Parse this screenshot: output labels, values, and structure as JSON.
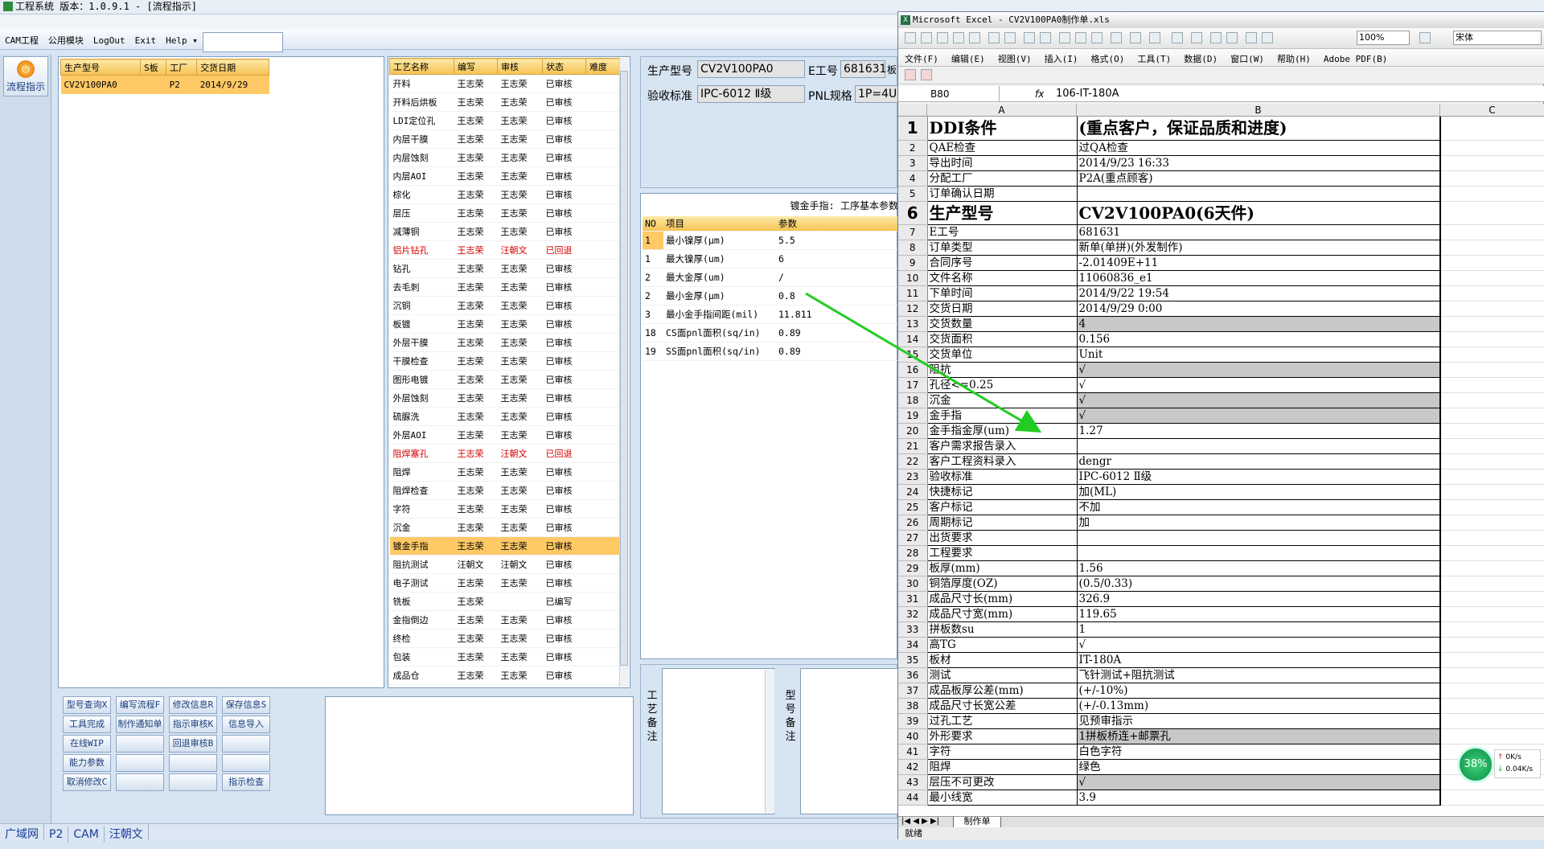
{
  "app": {
    "title": "工程系统  版本：1.0.9.1 - [流程指示]",
    "menu": [
      "CAM工程",
      "公用模块",
      "LogOut",
      "Exit",
      "Help ▾"
    ],
    "nav_button": "流程指示",
    "status_tabs": [
      "广域网",
      "P2",
      "CAM",
      "汪朝文"
    ]
  },
  "orders": {
    "columns": [
      "生产型号",
      "S板",
      "工厂",
      "交货日期"
    ],
    "rows": [
      {
        "model": "CV2V100PA0",
        "s": "",
        "factory": "P2",
        "date": "2014/9/29"
      }
    ]
  },
  "processes": {
    "columns": [
      "工艺名称",
      "编写",
      "审核",
      "状态",
      "难度"
    ],
    "rows": [
      {
        "name": "开料",
        "writer": "王志荣",
        "reviewer": "王志荣",
        "status": "已审核",
        "red": false
      },
      {
        "name": "开料后烘板",
        "writer": "王志荣",
        "reviewer": "王志荣",
        "status": "已审核",
        "red": false
      },
      {
        "name": "LDI定位孔",
        "writer": "王志荣",
        "reviewer": "王志荣",
        "status": "已审核",
        "red": false
      },
      {
        "name": "内层干膜",
        "writer": "王志荣",
        "reviewer": "王志荣",
        "status": "已审核",
        "red": false
      },
      {
        "name": "内层蚀刻",
        "writer": "王志荣",
        "reviewer": "王志荣",
        "status": "已审核",
        "red": false
      },
      {
        "name": "内层AOI",
        "writer": "王志荣",
        "reviewer": "王志荣",
        "status": "已审核",
        "red": false
      },
      {
        "name": "棕化",
        "writer": "王志荣",
        "reviewer": "王志荣",
        "status": "已审核",
        "red": false
      },
      {
        "name": "层压",
        "writer": "王志荣",
        "reviewer": "王志荣",
        "status": "已审核",
        "red": false
      },
      {
        "name": "减薄铜",
        "writer": "王志荣",
        "reviewer": "王志荣",
        "status": "已审核",
        "red": false
      },
      {
        "name": "铝片钻孔",
        "writer": "王志荣",
        "reviewer": "汪朝文",
        "status": "已回退",
        "red": true
      },
      {
        "name": "钻孔",
        "writer": "王志荣",
        "reviewer": "王志荣",
        "status": "已审核",
        "red": false
      },
      {
        "name": "去毛刺",
        "writer": "王志荣",
        "reviewer": "王志荣",
        "status": "已审核",
        "red": false
      },
      {
        "name": "沉铜",
        "writer": "王志荣",
        "reviewer": "王志荣",
        "status": "已审核",
        "red": false
      },
      {
        "name": "板镀",
        "writer": "王志荣",
        "reviewer": "王志荣",
        "status": "已审核",
        "red": false
      },
      {
        "name": "外层干膜",
        "writer": "王志荣",
        "reviewer": "王志荣",
        "status": "已审核",
        "red": false
      },
      {
        "name": "干膜检查",
        "writer": "王志荣",
        "reviewer": "王志荣",
        "status": "已审核",
        "red": false
      },
      {
        "name": "图形电镀",
        "writer": "王志荣",
        "reviewer": "王志荣",
        "status": "已审核",
        "red": false
      },
      {
        "name": "外层蚀刻",
        "writer": "王志荣",
        "reviewer": "王志荣",
        "status": "已审核",
        "red": false
      },
      {
        "name": "硫脲洗",
        "writer": "王志荣",
        "reviewer": "王志荣",
        "status": "已审核",
        "red": false
      },
      {
        "name": "外层AOI",
        "writer": "王志荣",
        "reviewer": "王志荣",
        "status": "已审核",
        "red": false
      },
      {
        "name": "阻焊塞孔",
        "writer": "王志荣",
        "reviewer": "汪朝文",
        "status": "已回退",
        "red": true
      },
      {
        "name": "阻焊",
        "writer": "王志荣",
        "reviewer": "王志荣",
        "status": "已审核",
        "red": false
      },
      {
        "name": "阻焊检查",
        "writer": "王志荣",
        "reviewer": "王志荣",
        "status": "已审核",
        "red": false
      },
      {
        "name": "字符",
        "writer": "王志荣",
        "reviewer": "王志荣",
        "status": "已审核",
        "red": false
      },
      {
        "name": "沉金",
        "writer": "王志荣",
        "reviewer": "王志荣",
        "status": "已审核",
        "red": false
      },
      {
        "name": "镀金手指",
        "writer": "王志荣",
        "reviewer": "王志荣",
        "status": "已审核",
        "red": false,
        "selected": true
      },
      {
        "name": "阻抗测试",
        "writer": "汪朝文",
        "reviewer": "汪朝文",
        "status": "已审核",
        "red": false
      },
      {
        "name": "电子测试",
        "writer": "王志荣",
        "reviewer": "王志荣",
        "status": "已审核",
        "red": false
      },
      {
        "name": "铣板",
        "writer": "王志荣",
        "reviewer": "",
        "status": "已编写",
        "red": false
      },
      {
        "name": "金指倒边",
        "writer": "王志荣",
        "reviewer": "王志荣",
        "status": "已审核",
        "red": false
      },
      {
        "name": "终检",
        "writer": "王志荣",
        "reviewer": "王志荣",
        "status": "已审核",
        "red": false
      },
      {
        "name": "包装",
        "writer": "王志荣",
        "reviewer": "王志荣",
        "status": "已审核",
        "red": false
      },
      {
        "name": "成品仓",
        "writer": "王志荣",
        "reviewer": "王志荣",
        "status": "已审核",
        "red": false
      }
    ]
  },
  "buttons": [
    [
      "型号查询X",
      "编写流程F",
      "修改信息R",
      "保存信息S"
    ],
    [
      "工具完成",
      "制作通知单",
      "指示审核K",
      "信息导入"
    ],
    [
      "在线WIP",
      "",
      "回退审核B",
      ""
    ],
    [
      "能力参数",
      "",
      "",
      ""
    ],
    [
      "取消修改C",
      "",
      "",
      "指示检查"
    ]
  ],
  "info": {
    "model_label": "生产型号",
    "model_value": "CV2V100PA0",
    "e_label": "E工号",
    "e_value": "681631",
    "e_extra": "板",
    "std_label": "验收标准",
    "std_value": "IPC-6012 Ⅱ级",
    "pnl_label": "PNL规格",
    "pnl_value": "1P=4U"
  },
  "params": {
    "title": "镀金手指: 工序基本参数",
    "columns": [
      "NO",
      "项目",
      "参数"
    ],
    "rows": [
      {
        "no": "1",
        "item": "最小镍厚(μm)",
        "value": "5.5",
        "hl": true
      },
      {
        "no": "1",
        "item": "最大镍厚(um)",
        "value": "6",
        "hl": false
      },
      {
        "no": "2",
        "item": "最大金厚(um)",
        "value": "/",
        "hl": false
      },
      {
        "no": "2",
        "item": "最小金厚(μm)",
        "value": "0.8",
        "hl": false
      },
      {
        "no": "3",
        "item": "最小金手指间距(mil)",
        "value": "11.811",
        "hl": false
      },
      {
        "no": "18",
        "item": "CS面pnl面积(sq/in)",
        "value": "0.89",
        "hl": false
      },
      {
        "no": "19",
        "item": "SS面pnl面积(sq/in)",
        "value": "0.89",
        "hl": false
      }
    ]
  },
  "memos": {
    "process_label": "工艺备注",
    "model_label": "型号备注"
  },
  "excel": {
    "title": "Microsoft Excel - CV2V100PA0制作单.xls",
    "menu": [
      "文件(F)",
      "编辑(E)",
      "视图(V)",
      "插入(I)",
      "格式(O)",
      "工具(T)",
      "数据(D)",
      "窗口(W)",
      "帮助(H)",
      "Adobe PDF(B)"
    ],
    "zoom": "100%",
    "font": "宋体",
    "namebox": "B80",
    "fx": "fx",
    "formula": "106-IT-180A",
    "columns": [
      "A",
      "B",
      "C"
    ],
    "sheet_tab": "制作单",
    "status": "就绪",
    "rows": [
      {
        "n": "1",
        "a": "DDI条件",
        "b": "(重点客户，保证品质和进度)",
        "big": true
      },
      {
        "n": "2",
        "a": "QAE检查",
        "b": "过QA检查"
      },
      {
        "n": "3",
        "a": "导出时间",
        "b": "2014/9/23 16:33"
      },
      {
        "n": "4",
        "a": "分配工厂",
        "b": "P2A(重点顾客)"
      },
      {
        "n": "5",
        "a": "订单确认日期",
        "b": ""
      },
      {
        "n": "6",
        "a": "生产型号",
        "b": "CV2V100PA0(6天件)",
        "big": true
      },
      {
        "n": "7",
        "a": "E工号",
        "b": "681631"
      },
      {
        "n": "8",
        "a": "订单类型",
        "b": "新单(单拼)(外发制作)"
      },
      {
        "n": "9",
        "a": "合同序号",
        "b": "-2.01409E+11"
      },
      {
        "n": "10",
        "a": "文件名称",
        "b": "11060836_e1"
      },
      {
        "n": "11",
        "a": "下单时间",
        "b": "2014/9/22 19:54"
      },
      {
        "n": "12",
        "a": "交货日期",
        "b": "2014/9/29 0:00"
      },
      {
        "n": "13",
        "a": "交货数量",
        "b": "4",
        "gray": true
      },
      {
        "n": "14",
        "a": "交货面积",
        "b": "0.156"
      },
      {
        "n": "15",
        "a": "交货单位",
        "b": "Unit"
      },
      {
        "n": "16",
        "a": "阻抗",
        "b": "√",
        "gray": true
      },
      {
        "n": "17",
        "a": "孔径<=0.25",
        "b": "√"
      },
      {
        "n": "18",
        "a": "沉金",
        "b": "√",
        "gray": true
      },
      {
        "n": "19",
        "a": "金手指",
        "b": "√",
        "gray": true
      },
      {
        "n": "20",
        "a": "金手指金厚(um)",
        "b": "1.27"
      },
      {
        "n": "21",
        "a": "客户需求报告录入",
        "b": ""
      },
      {
        "n": "22",
        "a": "客户工程资料录入",
        "b": "dengr"
      },
      {
        "n": "23",
        "a": "验收标准",
        "b": "IPC-6012 Ⅱ级"
      },
      {
        "n": "24",
        "a": "快捷标记",
        "b": "加(ML)"
      },
      {
        "n": "25",
        "a": "客户标记",
        "b": "不加"
      },
      {
        "n": "26",
        "a": "周期标记",
        "b": "加"
      },
      {
        "n": "27",
        "a": "出货要求",
        "b": ""
      },
      {
        "n": "28",
        "a": "工程要求",
        "b": ""
      },
      {
        "n": "29",
        "a": "板厚(mm)",
        "b": "1.56"
      },
      {
        "n": "30",
        "a": "铜箔厚度(OZ)",
        "b": "(0.5/0.33)"
      },
      {
        "n": "31",
        "a": "成品尺寸长(mm)",
        "b": "326.9"
      },
      {
        "n": "32",
        "a": "成品尺寸宽(mm)",
        "b": "119.65"
      },
      {
        "n": "33",
        "a": "拼板数su",
        "b": "1"
      },
      {
        "n": "34",
        "a": "高TG",
        "b": "√"
      },
      {
        "n": "35",
        "a": "板材",
        "b": "IT-180A"
      },
      {
        "n": "36",
        "a": "测试",
        "b": "飞针测试+阻抗测试"
      },
      {
        "n": "37",
        "a": "成品板厚公差(mm)",
        "b": "(+/-10%)"
      },
      {
        "n": "38",
        "a": "成品尺寸长宽公差",
        "b": "(+/-0.13mm)"
      },
      {
        "n": "39",
        "a": "过孔工艺",
        "b": "见预审指示"
      },
      {
        "n": "40",
        "a": "外形要求",
        "b": "1拼板桥连+邮票孔",
        "gray": true
      },
      {
        "n": "41",
        "a": "字符",
        "b": "白色字符"
      },
      {
        "n": "42",
        "a": "阻焊",
        "b": "绿色"
      },
      {
        "n": "43",
        "a": "层压不可更改",
        "b": "√",
        "gray": true
      },
      {
        "n": "44",
        "a": "最小线宽",
        "b": "3.9"
      }
    ]
  },
  "net": {
    "percent": "38%",
    "up": "0K/s",
    "down": "0.04K/s"
  },
  "colors": {
    "accent": "#f5c253",
    "selected": "#ffc966",
    "red": "#d40000",
    "arrow": "#22cc22"
  }
}
